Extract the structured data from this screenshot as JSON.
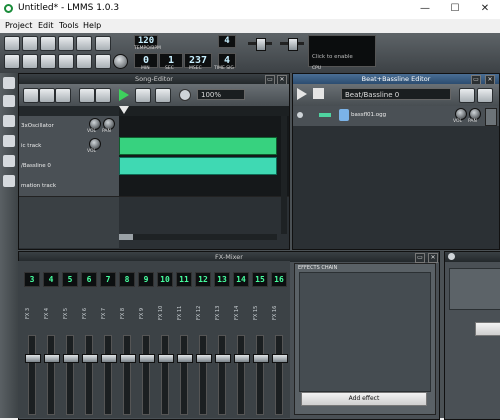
{
  "window": {
    "title": "Untitled* - LMMS 1.0.3",
    "minimize": "—",
    "maximize": "☐",
    "close": "✕"
  },
  "menu": {
    "items": [
      "Project",
      "Edit",
      "Tools",
      "Help"
    ]
  },
  "toolbar": {
    "tempo_value": "120",
    "tempo_label": "TEMPO/BPM",
    "min_value": "0",
    "min_label": "MIN",
    "sec_value": "1",
    "sec_label": "SEC",
    "msec_value": "237",
    "msec_label": "MSEC",
    "timesig_top": "4",
    "timesig_bottom": "4",
    "timesig_label": "TIME SIG",
    "cpu_hint": "Click to enable",
    "cpu_label": "CPU"
  },
  "song_editor": {
    "title": "Song-Editor",
    "zoom": "100%",
    "tracks": [
      {
        "name": "3xOscillator",
        "vol": "VOL",
        "pan": "PAN"
      },
      {
        "name": "ic track",
        "vol": "VOL",
        "pan": ""
      },
      {
        "name": "/Bassline 0",
        "vol": "",
        "pan": ""
      },
      {
        "name": "mation track",
        "vol": "",
        "pan": ""
      }
    ]
  },
  "beat_editor": {
    "title": "Beat+Bassline Editor",
    "selector": "Beat/Bassline 0",
    "instrument": "bassfl01.ogg",
    "vol": "VOL",
    "pan": "PAN"
  },
  "fx_mixer": {
    "title": "FX-Mixer",
    "channels": [
      "3",
      "4",
      "5",
      "6",
      "7",
      "8",
      "9",
      "10",
      "11",
      "12",
      "13",
      "14",
      "15",
      "16"
    ],
    "channel_labels": [
      "FX 3",
      "FX 4",
      "FX 5",
      "FX 6",
      "FX 7",
      "FX 8",
      "FX 9",
      "FX 10",
      "FX 11",
      "FX 12",
      "FX 13",
      "FX 14",
      "FX 15",
      "FX 16"
    ],
    "effects_chain_label": "EFFECTS CHAIN",
    "add_effect": "Add effect"
  },
  "colors": {
    "pattern_green": "#37d27f",
    "lcd_green": "#47ff9f",
    "active_titlebar": "#3e6388"
  }
}
